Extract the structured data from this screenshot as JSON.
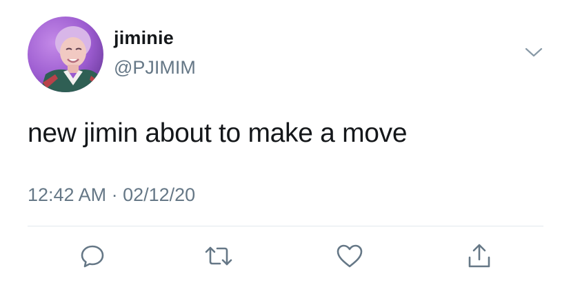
{
  "tweet": {
    "author": {
      "name": "jiminie",
      "handle": "@PJIMIM",
      "avatar_icon": "profile-photo"
    },
    "text": "new jimin about to make a move",
    "timestamp": "12:42 AM · 02/12/20",
    "menu_icon": "chevron-down-icon",
    "actions": [
      {
        "icon": "reply-icon"
      },
      {
        "icon": "retweet-icon"
      },
      {
        "icon": "heart-icon"
      },
      {
        "icon": "share-icon"
      }
    ]
  },
  "colors": {
    "text_primary": "#14171a",
    "text_secondary": "#657786",
    "divider": "#e1e8ed",
    "icon": "#657786",
    "background": "#ffffff"
  }
}
